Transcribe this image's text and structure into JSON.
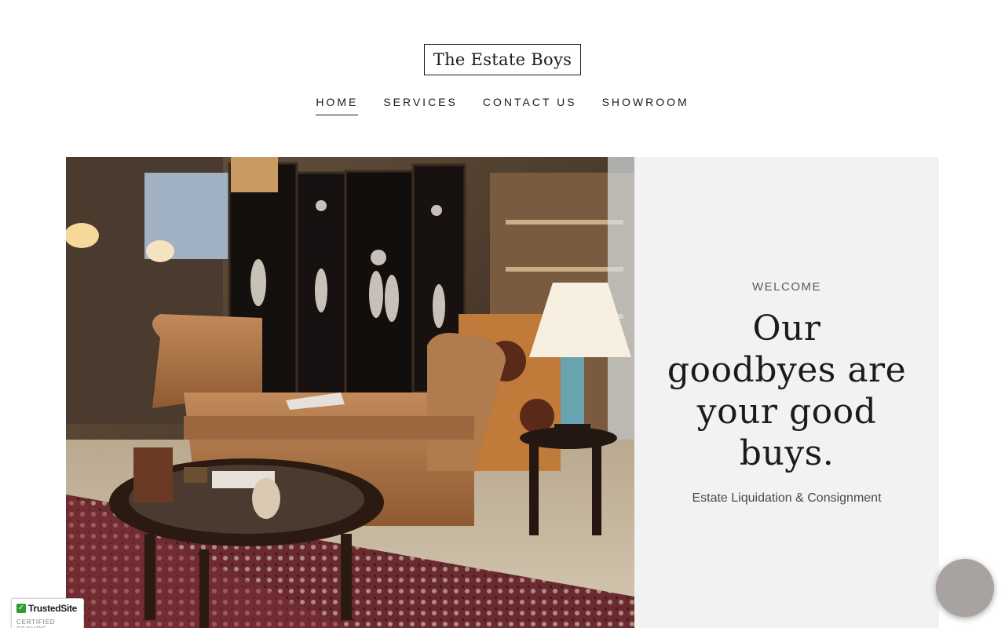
{
  "site": {
    "logo_text": "The Estate Boys"
  },
  "nav": {
    "items": [
      {
        "label": "HOME"
      },
      {
        "label": "SERVICES"
      },
      {
        "label": "CONTACT US"
      },
      {
        "label": "SHOWROOM"
      }
    ]
  },
  "hero": {
    "eyebrow": "WELCOME",
    "headline": "Our goodbyes are your good buys.",
    "tagline": "Estate Liquidation & Consignment",
    "panel_color": "#f2f2f2"
  },
  "badge": {
    "name": "TrustedSite",
    "subtitle": "CERTIFIED SECURE",
    "check_icon": "check-icon",
    "color": "#2e9b2f"
  },
  "chat": {
    "icon": "chat-bubble-icon",
    "color": "#a8a2a0"
  }
}
